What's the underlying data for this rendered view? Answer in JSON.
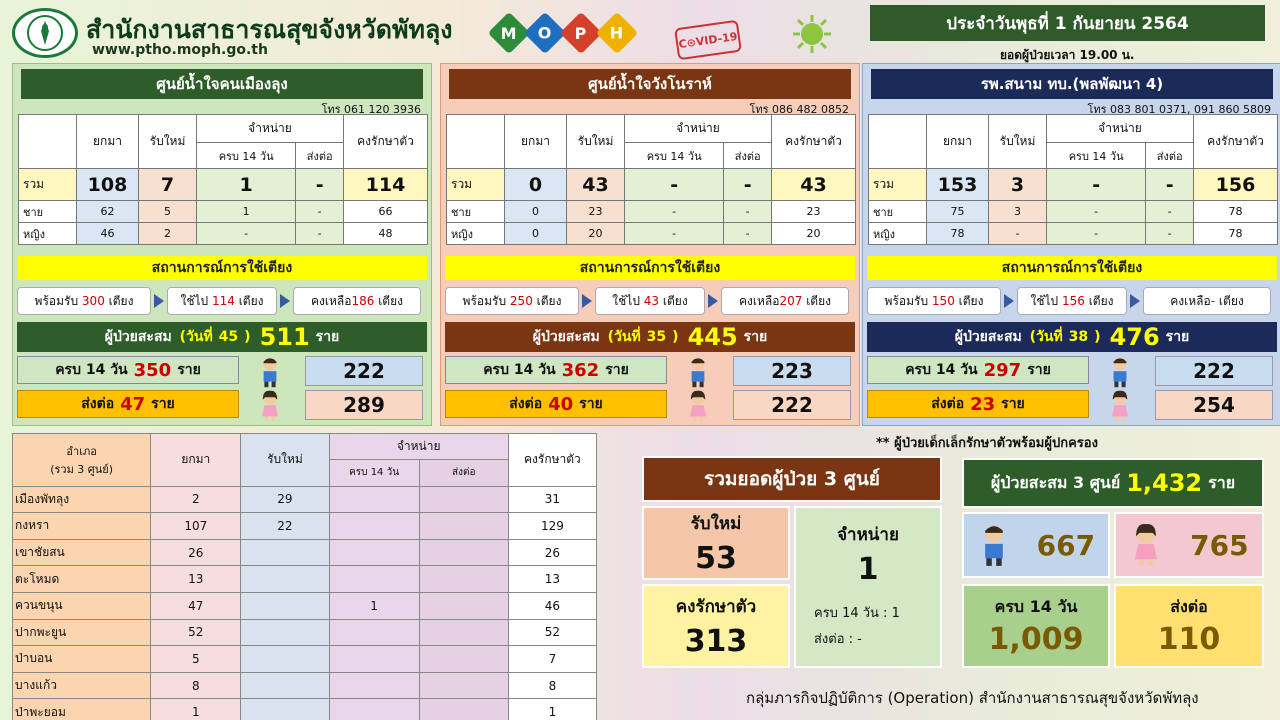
{
  "header": {
    "org_name": "สำนักงานสาธารณสุขจังหวัดพัทลุง",
    "website": "www.ptho.moph.go.th",
    "moph_letters": [
      "M",
      "O",
      "P",
      "H"
    ],
    "moph_colors": [
      "#2e8b3a",
      "#1f6fbf",
      "#d4402a",
      "#f0b000"
    ],
    "covid_badge": "C⊙VID-19",
    "date": "ประจำวันพุธที่ 1 กันยายน 2564",
    "as_of": "ยอดผู้ป่วยเวลา 19.00 น."
  },
  "labels": {
    "carried": "ยกมา",
    "new": "รับใหม่",
    "discharge": "จำหน่าย",
    "complete14": "ครบ 14 วัน",
    "refer": "ส่งต่อ",
    "remaining": "คงรักษาตัว",
    "total": "รวม",
    "male": "ชาย",
    "female": "หญิง",
    "bed_status": "สถานการณ์การใช้เตียง",
    "ready_pre": "พร้อมรับ",
    "used_pre": "ใช้ไป",
    "left_pre": "คงเหลือ",
    "bed_unit": "เตียง",
    "cum_pre": "ผู้ป่วยสะสม",
    "day_open": "(วันที่",
    "day_close": ")",
    "person_unit": "ราย"
  },
  "centers": [
    {
      "name": "ศูนย์น้ำใจคนเมืองลุง",
      "phone": "โทร 061 120 3936",
      "total": {
        "carried": "108",
        "new": "7",
        "complete14": "1",
        "refer": "-",
        "remaining": "114"
      },
      "male": {
        "carried": "62",
        "new": "5",
        "complete14": "1",
        "refer": "-",
        "remaining": "66"
      },
      "female": {
        "carried": "46",
        "new": "2",
        "complete14": "-",
        "refer": "-",
        "remaining": "48"
      },
      "beds": {
        "ready": "300",
        "used": "114",
        "left": "186"
      },
      "cumulative": {
        "day": "45",
        "count": "511"
      },
      "complete14_count": "350",
      "refer_count": "47",
      "boys": "222",
      "girls": "289"
    },
    {
      "name": "ศูนย์น้ำใจวังโนราห์",
      "phone": "โทร 086 482 0852",
      "total": {
        "carried": "0",
        "new": "43",
        "complete14": "-",
        "refer": "-",
        "remaining": "43"
      },
      "male": {
        "carried": "0",
        "new": "23",
        "complete14": "-",
        "refer": "-",
        "remaining": "23"
      },
      "female": {
        "carried": "0",
        "new": "20",
        "complete14": "-",
        "refer": "-",
        "remaining": "20"
      },
      "beds": {
        "ready": "250",
        "used": "43",
        "left": "207"
      },
      "cumulative": {
        "day": "35",
        "count": "445"
      },
      "complete14_count": "362",
      "refer_count": "40",
      "boys": "223",
      "girls": "222"
    },
    {
      "name": "รพ.สนาม ทบ.(พลพัฒนา 4)",
      "phone": "โทร 083 801 0371, 091 860 5809",
      "total": {
        "carried": "153",
        "new": "3",
        "complete14": "-",
        "refer": "-",
        "remaining": "156"
      },
      "male": {
        "carried": "75",
        "new": "3",
        "complete14": "-",
        "refer": "-",
        "remaining": "78"
      },
      "female": {
        "carried": "78",
        "new": "-",
        "complete14": "-",
        "refer": "-",
        "remaining": "78"
      },
      "beds": {
        "ready": "150",
        "used": "156",
        "left": "-"
      },
      "cumulative": {
        "day": "38",
        "count": "476"
      },
      "complete14_count": "297",
      "refer_count": "23",
      "boys": "222",
      "girls": "254"
    }
  ],
  "district_table": {
    "header_district": "อำเภอ",
    "header_district_sub": "(รวม 3 ศูนย์)",
    "rows": [
      {
        "name": "เมืองพัทลุง",
        "carried": "2",
        "new": "29",
        "c14": "",
        "refer": "",
        "remaining": "31"
      },
      {
        "name": "กงหรา",
        "carried": "107",
        "new": "22",
        "c14": "",
        "refer": "",
        "remaining": "129"
      },
      {
        "name": "เขาชัยสน",
        "carried": "26",
        "new": "",
        "c14": "",
        "refer": "",
        "remaining": "26"
      },
      {
        "name": "ตะโหมด",
        "carried": "13",
        "new": "",
        "c14": "",
        "refer": "",
        "remaining": "13"
      },
      {
        "name": "ควนขนุน",
        "carried": "47",
        "new": "",
        "c14": "1",
        "refer": "",
        "remaining": "46"
      },
      {
        "name": "ปากพะยูน",
        "carried": "52",
        "new": "",
        "c14": "",
        "refer": "",
        "remaining": "52"
      },
      {
        "name": "ป่าบอน",
        "carried": "5",
        "new": "",
        "c14": "",
        "refer": "",
        "remaining": "7"
      },
      {
        "name": "บางแก้ว",
        "carried": "8",
        "new": "",
        "c14": "",
        "refer": "",
        "remaining": "8"
      },
      {
        "name": "ป่าพะยอม",
        "carried": "1",
        "new": "",
        "c14": "",
        "refer": "",
        "remaining": "1"
      }
    ]
  },
  "note": "** ผู้ป่วยเด็กเล็กรักษาตัวพร้อมผู้ปกครอง",
  "summary": {
    "title": "รวมยอดผู้ป่วย 3 ศูนย์",
    "new_label": "รับใหม่",
    "new_value": "53",
    "discharge_label": "จำหน่าย",
    "discharge_value": "1",
    "discharge_c14": "ครบ 14 วัน   : 1",
    "discharge_refer": "ส่งต่อ : -",
    "remaining_label": "คงรักษาตัว",
    "remaining_value": "313",
    "cum_label": "ผู้ป่วยสะสม 3 ศูนย์",
    "cum_value": "1,432",
    "cum_unit": "ราย",
    "boys": "667",
    "girls": "765",
    "c14_label": "ครบ 14 วัน",
    "c14_value": "1,009",
    "refer_label": "ส่งต่อ",
    "refer_value": "110"
  },
  "footer": "กลุ่มภารกิจปฏิบัติการ (Operation) สำนักงานสาธารณสุขจังหวัดพัทลุง"
}
